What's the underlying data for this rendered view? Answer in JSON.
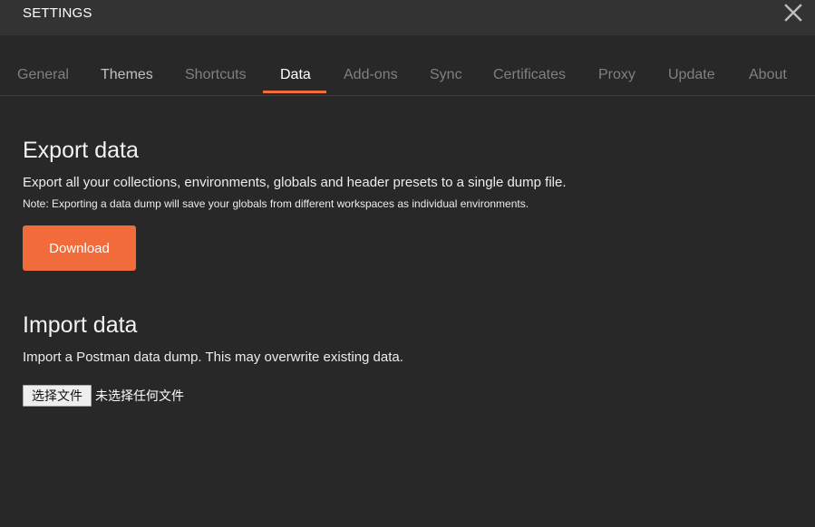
{
  "header": {
    "title": "SETTINGS",
    "close_icon": "close-icon"
  },
  "tabs": [
    {
      "label": "General"
    },
    {
      "label": "Themes"
    },
    {
      "label": "Shortcuts"
    },
    {
      "label": "Data"
    },
    {
      "label": "Add-ons"
    },
    {
      "label": "Sync"
    },
    {
      "label": "Certificates"
    },
    {
      "label": "Proxy"
    },
    {
      "label": "Update"
    },
    {
      "label": "About"
    }
  ],
  "active_tab": "Data",
  "export": {
    "title": "Export data",
    "description": "Export all your collections, environments, globals and header presets to a single dump file.",
    "note": "Note: Exporting a data dump will save your globals from different workspaces as individual environments.",
    "button_label": "Download"
  },
  "import": {
    "title": "Import data",
    "description": "Import a Postman data dump. This may overwrite existing data.",
    "file_button_label": "选择文件",
    "file_status": "未选择任何文件"
  },
  "colors": {
    "accent": "#f26b3a",
    "background": "#282828",
    "header_background": "#333333"
  }
}
